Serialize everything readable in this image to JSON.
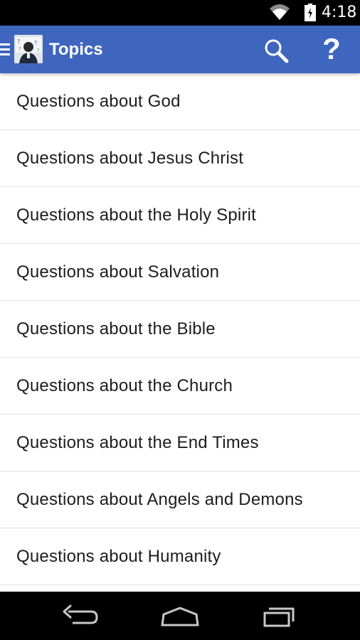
{
  "status_bar": {
    "time": "4:18",
    "icons": [
      "wifi-icon",
      "battery-charging-icon"
    ]
  },
  "app_bar": {
    "title": "Topics",
    "background_color": "#3f66be",
    "icons": [
      "menu-icon",
      "app-logo",
      "search-icon",
      "help-icon"
    ],
    "help_glyph": "?"
  },
  "topics": [
    {
      "label": "Questions about God"
    },
    {
      "label": "Questions about Jesus Christ"
    },
    {
      "label": "Questions about the Holy Spirit"
    },
    {
      "label": "Questions about Salvation"
    },
    {
      "label": "Questions about the Bible"
    },
    {
      "label": "Questions about the Church"
    },
    {
      "label": "Questions about the End Times"
    },
    {
      "label": "Questions about Angels and Demons"
    },
    {
      "label": "Questions about Humanity"
    }
  ],
  "nav_bar": {
    "icons": [
      "back-icon",
      "home-icon",
      "recents-icon"
    ]
  }
}
